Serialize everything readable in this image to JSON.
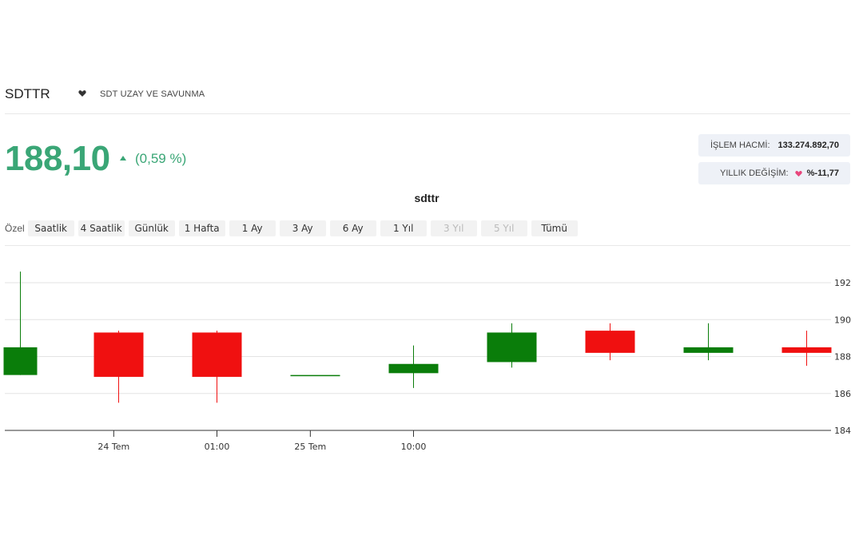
{
  "header": {
    "ticker": "SDTTR",
    "company": "SDT UZAY VE SAVUNMA"
  },
  "quote": {
    "price": "188,10",
    "change": "(0,59 %)"
  },
  "stats": {
    "volume_label": "İŞLEM HACMİ:",
    "volume_value": "133.274.892,70",
    "yearly_label": "YILLIK DEĞİŞİM:",
    "yearly_value": "%-11,77"
  },
  "ranges": {
    "label": "Özel",
    "buttons": [
      {
        "label": "Saatlik",
        "enabled": true
      },
      {
        "label": "4 Saatlik",
        "enabled": true
      },
      {
        "label": "Günlük",
        "enabled": true
      },
      {
        "label": "1 Hafta",
        "enabled": true
      },
      {
        "label": "1 Ay",
        "enabled": true
      },
      {
        "label": "3 Ay",
        "enabled": true
      },
      {
        "label": "6 Ay",
        "enabled": true
      },
      {
        "label": "1 Yıl",
        "enabled": true
      },
      {
        "label": "3 Yıl",
        "enabled": false
      },
      {
        "label": "5 Yıl",
        "enabled": false
      },
      {
        "label": "Tümü",
        "enabled": true
      }
    ]
  },
  "colors": {
    "up_text": "#3aa676",
    "candle_up": "#0a7d0a",
    "candle_down": "#f01010",
    "heart_small": "#333333",
    "heart_pink": "#e8467c"
  },
  "chart_data": {
    "type": "candlestick",
    "title": "sdttr",
    "ylim": [
      184,
      193
    ],
    "yticks": [
      184,
      186,
      188,
      190,
      192
    ],
    "x_tick_labels": [
      {
        "index": 0.95,
        "label": "24 Tem"
      },
      {
        "index": 2.0,
        "label": "01:00"
      },
      {
        "index": 2.95,
        "label": "25 Tem"
      },
      {
        "index": 4.0,
        "label": "10:00"
      }
    ],
    "candles": [
      {
        "open": 187.0,
        "high": 192.6,
        "low": 187.0,
        "close": 188.5
      },
      {
        "open": 189.3,
        "high": 189.4,
        "low": 185.5,
        "close": 186.9
      },
      {
        "open": 189.3,
        "high": 189.4,
        "low": 185.5,
        "close": 186.9
      },
      {
        "open": 187.0,
        "high": 187.0,
        "low": 187.0,
        "close": 187.0
      },
      {
        "open": 187.1,
        "high": 188.6,
        "low": 186.3,
        "close": 187.6
      },
      {
        "open": 187.7,
        "high": 189.8,
        "low": 187.4,
        "close": 189.3
      },
      {
        "open": 189.4,
        "high": 189.8,
        "low": 187.8,
        "close": 188.2
      },
      {
        "open": 188.2,
        "high": 189.8,
        "low": 187.8,
        "close": 188.5
      },
      {
        "open": 188.5,
        "high": 189.4,
        "low": 187.5,
        "close": 188.2
      }
    ]
  }
}
